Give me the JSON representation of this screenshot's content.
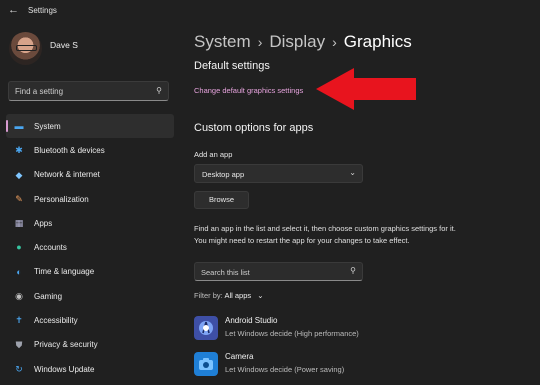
{
  "window": {
    "title": "Settings",
    "back_glyph": "←"
  },
  "user": {
    "name": "Dave S"
  },
  "sidebar": {
    "search_placeholder": "Find a setting",
    "items": [
      {
        "label": "System",
        "icon": "monitor-icon",
        "glyph": "▬",
        "color": "#4aa6f0",
        "active": true
      },
      {
        "label": "Bluetooth & devices",
        "icon": "bluetooth-icon",
        "glyph": "✱",
        "color": "#4aa6f0"
      },
      {
        "label": "Network & internet",
        "icon": "wifi-icon",
        "glyph": "◆",
        "color": "#7fc6ff"
      },
      {
        "label": "Personalization",
        "icon": "brush-icon",
        "glyph": "✎",
        "color": "#f0a060"
      },
      {
        "label": "Apps",
        "icon": "apps-icon",
        "glyph": "▦",
        "color": "#b7b7d8"
      },
      {
        "label": "Accounts",
        "icon": "person-icon",
        "glyph": "●",
        "color": "#36c4a0"
      },
      {
        "label": "Time & language",
        "icon": "globe-icon",
        "glyph": "◐",
        "color": "#4aa6f0"
      },
      {
        "label": "Gaming",
        "icon": "gamepad-icon",
        "glyph": "◉",
        "color": "#bfbfbf"
      },
      {
        "label": "Accessibility",
        "icon": "accessibility-icon",
        "glyph": "✝",
        "color": "#4aa6f0"
      },
      {
        "label": "Privacy & security",
        "icon": "shield-icon",
        "glyph": "⛊",
        "color": "#9ea2ad"
      },
      {
        "label": "Windows Update",
        "icon": "update-icon",
        "glyph": "↻",
        "color": "#4aa6f0"
      }
    ]
  },
  "breadcrumb": {
    "part1": "System",
    "part2": "Display",
    "current": "Graphics",
    "sep": "›"
  },
  "default_settings": {
    "heading": "Default settings",
    "link": "Change default graphics settings"
  },
  "custom": {
    "heading": "Custom options for apps",
    "add_label": "Add an app",
    "dropdown_value": "Desktop app",
    "browse_label": "Browse",
    "description": "Find an app in the list and select it, then choose custom graphics settings for it. You might need to restart the app for your changes to take effect.",
    "search_placeholder": "Search this list",
    "filter_label": "Filter by:",
    "filter_value": "All apps"
  },
  "apps": [
    {
      "name": "Android Studio",
      "subtitle": "Let Windows decide (High performance)",
      "icon": "android-studio-icon"
    },
    {
      "name": "Camera",
      "subtitle": "Let Windows decide (Power saving)",
      "icon": "camera-icon"
    }
  ],
  "colors": {
    "accent": "#e6a3dd",
    "annotation_arrow": "#e8141e",
    "background": "#202020"
  }
}
